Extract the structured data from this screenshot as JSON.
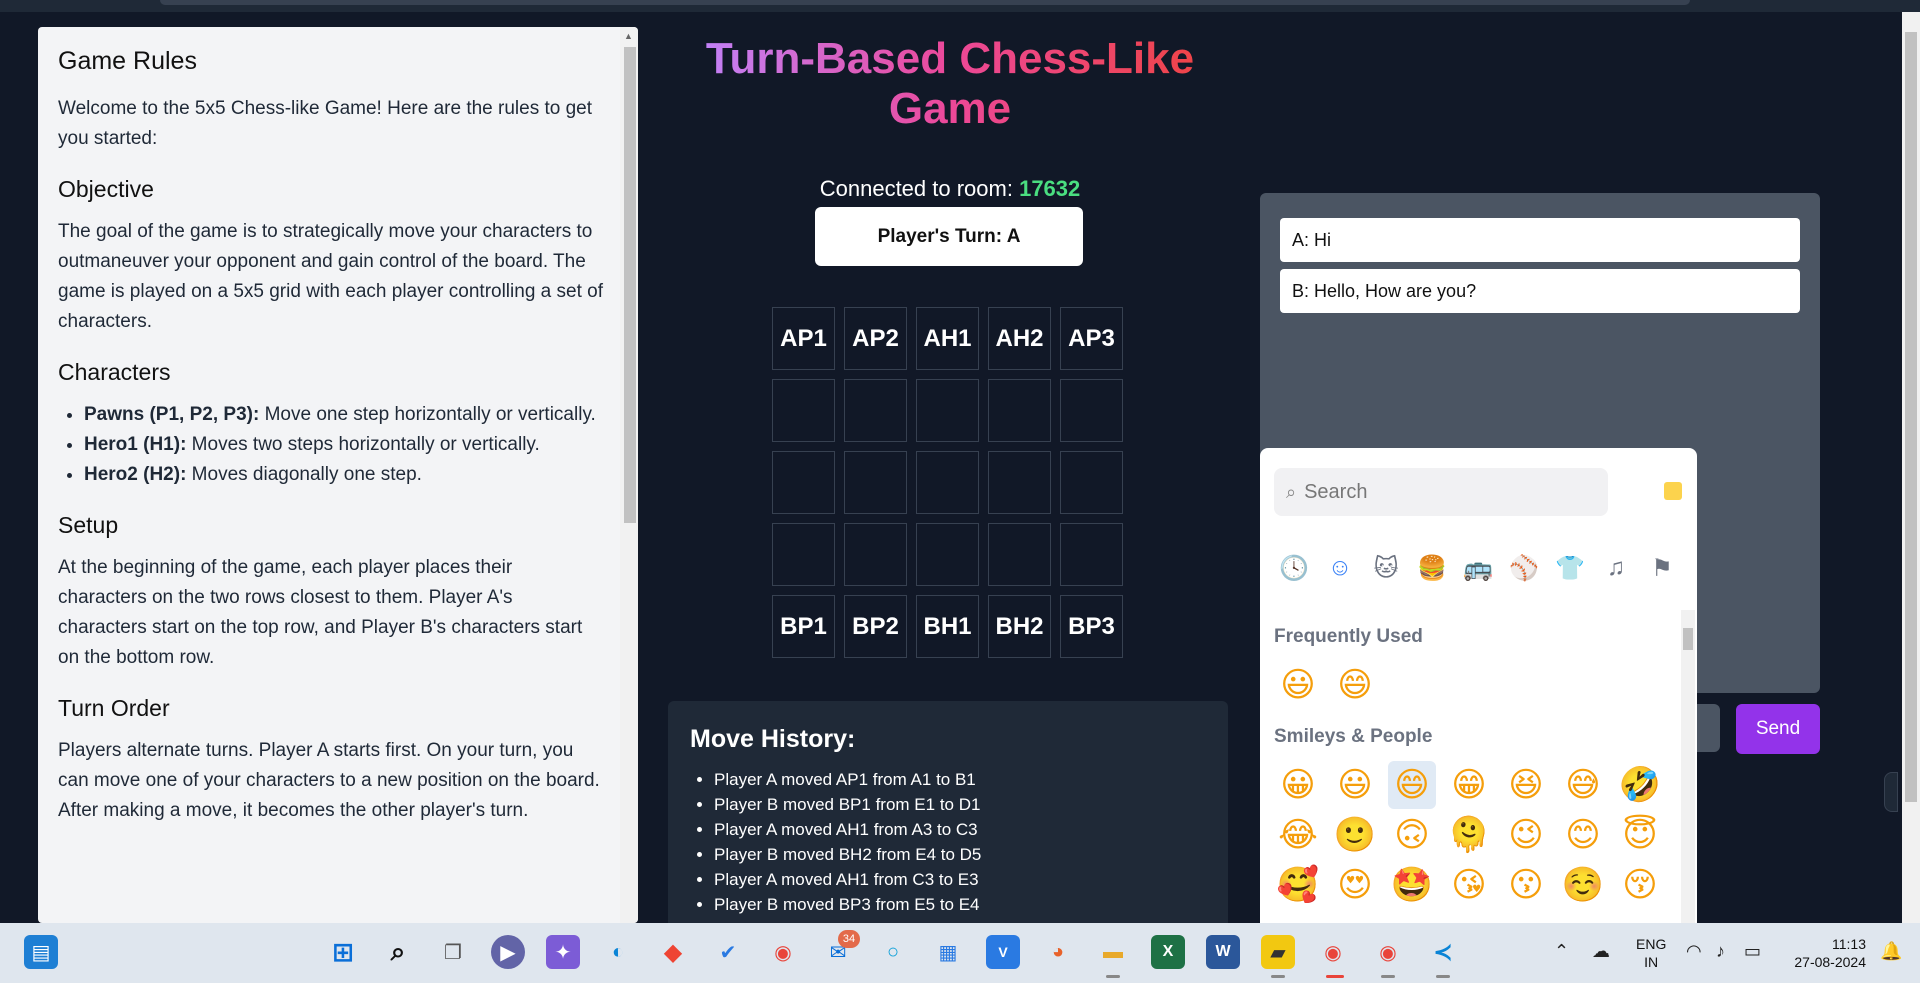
{
  "rules": {
    "title": "Game Rules",
    "intro": "Welcome to the 5x5 Chess-like Game! Here are the rules to get you started:",
    "objective_heading": "Objective",
    "objective_text": "The goal of the game is to strategically move your characters to outmaneuver your opponent and gain control of the board. The game is played on a 5x5 grid with each player controlling a set of characters.",
    "characters_heading": "Characters",
    "characters": [
      {
        "name": "Pawns (P1, P2, P3):",
        "desc": " Move one step horizontally or vertically."
      },
      {
        "name": "Hero1 (H1):",
        "desc": " Moves two steps horizontally or vertically."
      },
      {
        "name": "Hero2 (H2):",
        "desc": " Moves diagonally one step."
      }
    ],
    "setup_heading": "Setup",
    "setup_text": "At the beginning of the game, each player places their characters on the two rows closest to them. Player A's characters start on the top row, and Player B's characters start on the bottom row.",
    "turn_heading": "Turn Order",
    "turn_text": "Players alternate turns. Player A starts first. On your turn, you can move one of your characters to a new position on the board. After making a move, it becomes the other player's turn."
  },
  "header": {
    "title": "Turn-Based Chess-Like Game",
    "room_prefix": "Connected to room: ",
    "room_number": "17632",
    "turn_label": "Player's Turn: A"
  },
  "board": {
    "rows": [
      [
        "AP1",
        "AP2",
        "AH1",
        "AH2",
        "AP3"
      ],
      [
        "",
        "",
        "",
        "",
        ""
      ],
      [
        "",
        "",
        "",
        "",
        ""
      ],
      [
        "",
        "",
        "",
        "",
        ""
      ],
      [
        "BP1",
        "BP2",
        "BH1",
        "BH2",
        "BP3"
      ]
    ]
  },
  "history": {
    "title": "Move History:",
    "moves": [
      "Player A moved AP1 from A1 to B1",
      "Player B moved BP1 from E1 to D1",
      "Player A moved AH1 from A3 to C3",
      "Player B moved BH2 from E4 to D5",
      "Player A moved AH1 from C3 to E3",
      "Player B moved BP3 from E5 to E4"
    ]
  },
  "chat": {
    "messages": [
      "A: Hi",
      "B: Hello, How are you?"
    ],
    "send_label": "Send"
  },
  "emoji_picker": {
    "search_placeholder": "Search",
    "categories": [
      "clock-icon",
      "smiley-icon",
      "cat-icon",
      "burger-icon",
      "bus-icon",
      "ball-icon",
      "shirt-icon",
      "music-icon",
      "flag-icon"
    ],
    "frequently_used_label": "Frequently Used",
    "frequently_used": [
      "😃",
      "😄"
    ],
    "smileys_label": "Smileys & People",
    "smileys": [
      [
        "😀",
        "😃",
        "😄",
        "😁",
        "😆",
        "😅",
        "🤣"
      ],
      [
        "😂",
        "🙂",
        "🙃",
        "🫠",
        "😉",
        "😊",
        "😇"
      ],
      [
        "🥰",
        "😍",
        "🤩",
        "😘",
        "😗",
        "☺️",
        "😚"
      ]
    ]
  },
  "taskbar": {
    "mail_badge": "34",
    "lang_line1": "ENG",
    "lang_line2": "IN",
    "time": "11:13",
    "date": "27-08-2024"
  },
  "colors": {
    "background": "#111827",
    "room_number": "#4ade80",
    "send_button": "#9333ea",
    "chat_panel": "#4b5563"
  }
}
